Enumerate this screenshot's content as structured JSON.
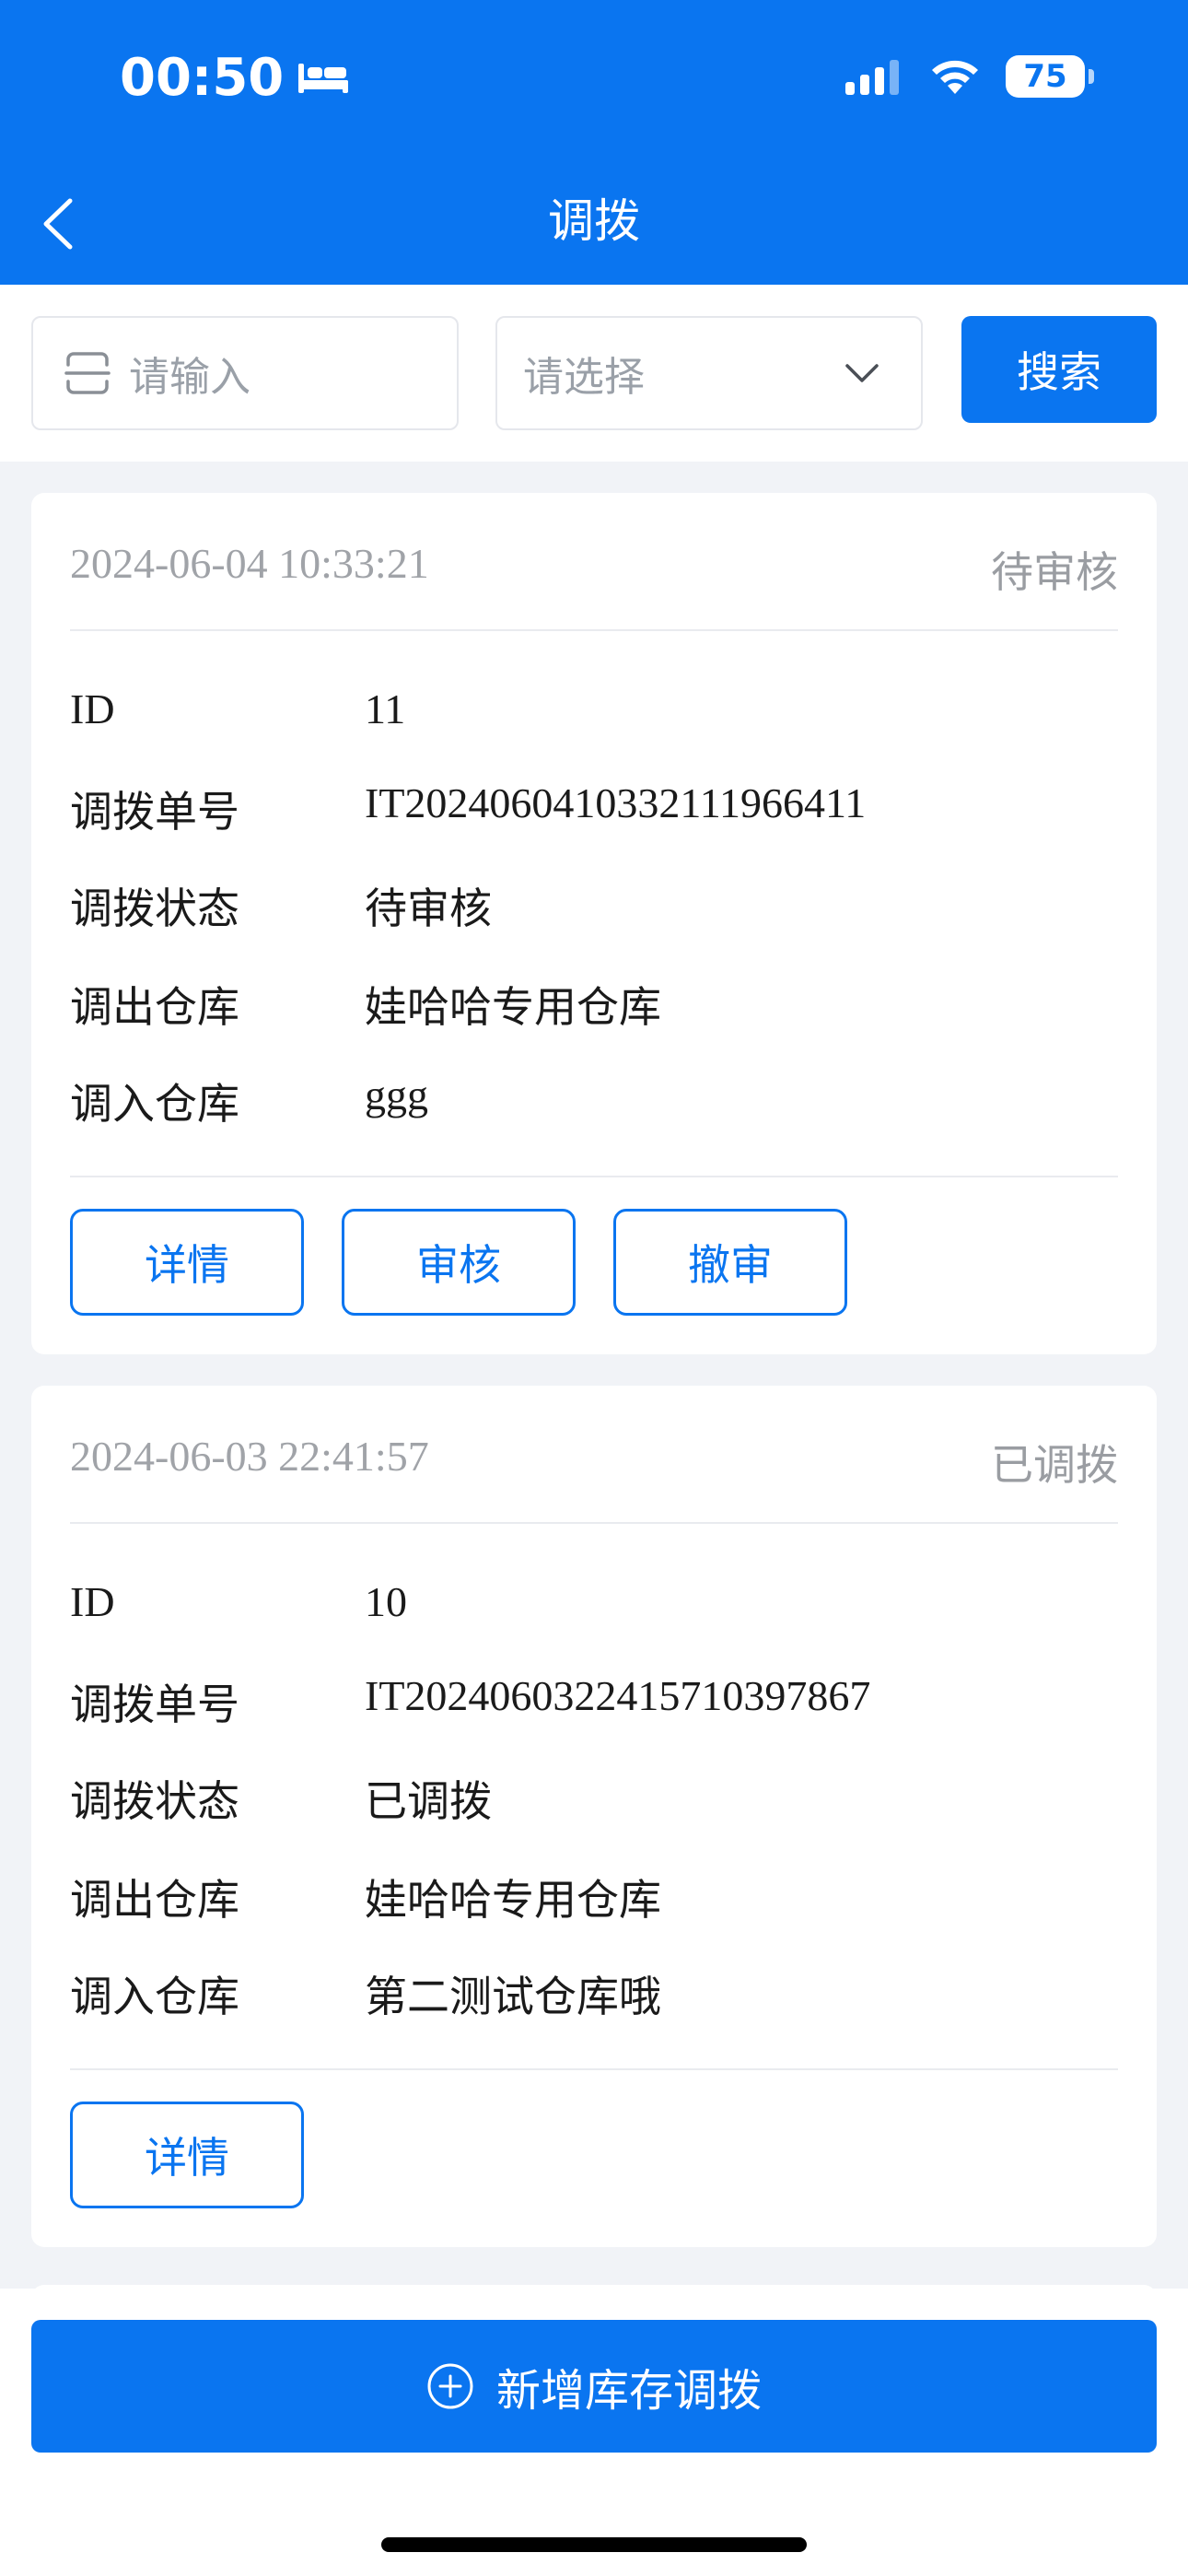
{
  "status_bar": {
    "time": "00:50",
    "battery": "75"
  },
  "nav": {
    "title": "调拨"
  },
  "search": {
    "input_placeholder": "请输入",
    "select_placeholder": "请选择",
    "button_label": "搜索"
  },
  "cards": [
    {
      "time": "2024-06-04 10:33:21",
      "status": "待审核",
      "rows": [
        {
          "label": "ID",
          "value": "11"
        },
        {
          "label": "调拨单号",
          "value": "IT2024060410332111966411"
        },
        {
          "label": "调拨状态",
          "value": "待审核"
        },
        {
          "label": "调出仓库",
          "value": "娃哈哈专用仓库"
        },
        {
          "label": "调入仓库",
          "value": "ggg"
        }
      ],
      "actions": [
        "详情",
        "审核",
        "撤审"
      ]
    },
    {
      "time": "2024-06-03 22:41:57",
      "status": "已调拨",
      "rows": [
        {
          "label": "ID",
          "value": "10"
        },
        {
          "label": "调拨单号",
          "value": "IT2024060322415710397867"
        },
        {
          "label": "调拨状态",
          "value": "已调拨"
        },
        {
          "label": "调出仓库",
          "value": "娃哈哈专用仓库"
        },
        {
          "label": "调入仓库",
          "value": "第二测试仓库哦"
        }
      ],
      "actions": [
        "详情"
      ]
    }
  ],
  "bottom": {
    "add_button_label": "新增库存调拨"
  },
  "colors": {
    "primary": "#0a75f0",
    "muted": "#a0a3a8"
  }
}
